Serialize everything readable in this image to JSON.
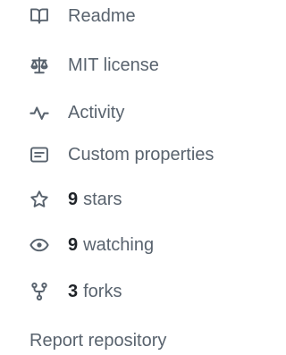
{
  "about": {
    "readme": {
      "label": "Readme",
      "icon": "book-icon"
    },
    "license": {
      "label": "MIT license",
      "icon": "law-icon"
    },
    "activity": {
      "label": "Activity",
      "icon": "pulse-icon"
    },
    "custom_properties": {
      "label": "Custom properties",
      "icon": "note-icon"
    },
    "stars": {
      "count": "9",
      "label": "stars",
      "icon": "star-icon"
    },
    "watching": {
      "count": "9",
      "label": "watching",
      "icon": "eye-icon"
    },
    "forks": {
      "count": "3",
      "label": "forks",
      "icon": "repo-forked-icon"
    },
    "report": {
      "label": "Report repository"
    }
  },
  "colors": {
    "muted_text": "#59636e",
    "count_text": "#1f2328",
    "icon": "#59636e"
  }
}
